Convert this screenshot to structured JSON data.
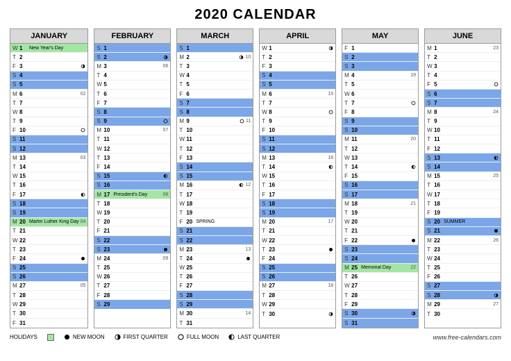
{
  "title": "2020 CALENDAR",
  "source": "www.free-calendars.com",
  "legend": {
    "holidays": "HOLIDAYS",
    "new": "NEW MOON",
    "first": "FIRST QUARTER",
    "full": "FULL MOON",
    "last": "LAST QUARTER"
  },
  "months": [
    {
      "name": "JANUARY",
      "days": [
        {
          "dw": "W",
          "n": 1,
          "hl": "green",
          "ev": "New Year's Day"
        },
        {
          "dw": "T",
          "n": 2
        },
        {
          "dw": "F",
          "n": 3,
          "moon": "first"
        },
        {
          "dw": "S",
          "n": 4,
          "hl": "blue"
        },
        {
          "dw": "S",
          "n": 5,
          "hl": "blue"
        },
        {
          "dw": "M",
          "n": 6,
          "wk": "02"
        },
        {
          "dw": "T",
          "n": 7
        },
        {
          "dw": "W",
          "n": 8
        },
        {
          "dw": "T",
          "n": 9
        },
        {
          "dw": "F",
          "n": 10,
          "moon": "full"
        },
        {
          "dw": "S",
          "n": 11,
          "hl": "blue"
        },
        {
          "dw": "S",
          "n": 12,
          "hl": "blue"
        },
        {
          "dw": "M",
          "n": 13,
          "wk": "03"
        },
        {
          "dw": "T",
          "n": 14
        },
        {
          "dw": "W",
          "n": 15
        },
        {
          "dw": "T",
          "n": 16
        },
        {
          "dw": "F",
          "n": 17,
          "moon": "last"
        },
        {
          "dw": "S",
          "n": 18,
          "hl": "blue"
        },
        {
          "dw": "S",
          "n": 19,
          "hl": "blue"
        },
        {
          "dw": "M",
          "n": 20,
          "hl": "green",
          "ev": "Martin Luther King Day",
          "wk": "04"
        },
        {
          "dw": "T",
          "n": 21
        },
        {
          "dw": "W",
          "n": 22
        },
        {
          "dw": "T",
          "n": 23
        },
        {
          "dw": "F",
          "n": 24,
          "moon": "new"
        },
        {
          "dw": "S",
          "n": 25,
          "hl": "blue"
        },
        {
          "dw": "S",
          "n": 26,
          "hl": "blue"
        },
        {
          "dw": "M",
          "n": 27,
          "wk": "05"
        },
        {
          "dw": "T",
          "n": 28
        },
        {
          "dw": "W",
          "n": 29
        },
        {
          "dw": "T",
          "n": 30
        },
        {
          "dw": "F",
          "n": 31
        }
      ]
    },
    {
      "name": "FEBRUARY",
      "days": [
        {
          "dw": "S",
          "n": 1,
          "hl": "blue"
        },
        {
          "dw": "S",
          "n": 2,
          "hl": "blue",
          "moon": "first"
        },
        {
          "dw": "M",
          "n": 3,
          "wk": "06"
        },
        {
          "dw": "T",
          "n": 4
        },
        {
          "dw": "W",
          "n": 5
        },
        {
          "dw": "T",
          "n": 6
        },
        {
          "dw": "F",
          "n": 7
        },
        {
          "dw": "S",
          "n": 8,
          "hl": "blue"
        },
        {
          "dw": "S",
          "n": 9,
          "hl": "blue",
          "moon": "full"
        },
        {
          "dw": "M",
          "n": 10,
          "wk": "07"
        },
        {
          "dw": "T",
          "n": 11
        },
        {
          "dw": "W",
          "n": 12
        },
        {
          "dw": "T",
          "n": 13
        },
        {
          "dw": "F",
          "n": 14
        },
        {
          "dw": "S",
          "n": 15,
          "hl": "blue",
          "moon": "last"
        },
        {
          "dw": "S",
          "n": 16,
          "hl": "blue"
        },
        {
          "dw": "M",
          "n": 17,
          "hl": "green",
          "ev": "President's Day",
          "wk": "08"
        },
        {
          "dw": "T",
          "n": 18
        },
        {
          "dw": "W",
          "n": 19
        },
        {
          "dw": "T",
          "n": 20
        },
        {
          "dw": "F",
          "n": 21
        },
        {
          "dw": "S",
          "n": 22,
          "hl": "blue"
        },
        {
          "dw": "S",
          "n": 23,
          "hl": "blue",
          "moon": "new"
        },
        {
          "dw": "M",
          "n": 24,
          "wk": "09"
        },
        {
          "dw": "T",
          "n": 25
        },
        {
          "dw": "W",
          "n": 26
        },
        {
          "dw": "T",
          "n": 27
        },
        {
          "dw": "F",
          "n": 28
        },
        {
          "dw": "S",
          "n": 29,
          "hl": "blue"
        }
      ]
    },
    {
      "name": "MARCH",
      "days": [
        {
          "dw": "S",
          "n": 1,
          "hl": "blue"
        },
        {
          "dw": "M",
          "n": 2,
          "moon": "first",
          "wk": "10"
        },
        {
          "dw": "T",
          "n": 3
        },
        {
          "dw": "W",
          "n": 4
        },
        {
          "dw": "T",
          "n": 5
        },
        {
          "dw": "F",
          "n": 6
        },
        {
          "dw": "S",
          "n": 7,
          "hl": "blue"
        },
        {
          "dw": "S",
          "n": 8,
          "hl": "blue"
        },
        {
          "dw": "M",
          "n": 9,
          "moon": "full",
          "wk": "11"
        },
        {
          "dw": "T",
          "n": 10
        },
        {
          "dw": "W",
          "n": 11
        },
        {
          "dw": "T",
          "n": 12
        },
        {
          "dw": "F",
          "n": 13
        },
        {
          "dw": "S",
          "n": 14,
          "hl": "blue"
        },
        {
          "dw": "S",
          "n": 15,
          "hl": "blue"
        },
        {
          "dw": "M",
          "n": 16,
          "moon": "last",
          "wk": "12"
        },
        {
          "dw": "T",
          "n": 17
        },
        {
          "dw": "W",
          "n": 18
        },
        {
          "dw": "T",
          "n": 19
        },
        {
          "dw": "F",
          "n": 20,
          "ev": "SPRING"
        },
        {
          "dw": "S",
          "n": 21,
          "hl": "blue"
        },
        {
          "dw": "S",
          "n": 22,
          "hl": "blue"
        },
        {
          "dw": "M",
          "n": 23,
          "wk": "13"
        },
        {
          "dw": "T",
          "n": 24,
          "moon": "new"
        },
        {
          "dw": "W",
          "n": 25
        },
        {
          "dw": "T",
          "n": 26
        },
        {
          "dw": "F",
          "n": 27
        },
        {
          "dw": "S",
          "n": 28,
          "hl": "blue"
        },
        {
          "dw": "S",
          "n": 29,
          "hl": "blue"
        },
        {
          "dw": "M",
          "n": 30,
          "wk": "14"
        },
        {
          "dw": "T",
          "n": 31
        }
      ]
    },
    {
      "name": "APRIL",
      "days": [
        {
          "dw": "W",
          "n": 1,
          "moon": "first"
        },
        {
          "dw": "T",
          "n": 2
        },
        {
          "dw": "F",
          "n": 3
        },
        {
          "dw": "S",
          "n": 4,
          "hl": "blue"
        },
        {
          "dw": "S",
          "n": 5,
          "hl": "blue"
        },
        {
          "dw": "M",
          "n": 6,
          "wk": "15"
        },
        {
          "dw": "T",
          "n": 7
        },
        {
          "dw": "W",
          "n": 8,
          "moon": "full"
        },
        {
          "dw": "T",
          "n": 9
        },
        {
          "dw": "F",
          "n": 10
        },
        {
          "dw": "S",
          "n": 11,
          "hl": "blue"
        },
        {
          "dw": "S",
          "n": 12,
          "hl": "blue"
        },
        {
          "dw": "M",
          "n": 13,
          "wk": "16"
        },
        {
          "dw": "T",
          "n": 14,
          "moon": "last"
        },
        {
          "dw": "W",
          "n": 15
        },
        {
          "dw": "T",
          "n": 16
        },
        {
          "dw": "F",
          "n": 17
        },
        {
          "dw": "S",
          "n": 18,
          "hl": "blue"
        },
        {
          "dw": "S",
          "n": 19,
          "hl": "blue"
        },
        {
          "dw": "M",
          "n": 20,
          "wk": "17"
        },
        {
          "dw": "T",
          "n": 21
        },
        {
          "dw": "W",
          "n": 22
        },
        {
          "dw": "T",
          "n": 23,
          "moon": "new"
        },
        {
          "dw": "F",
          "n": 24
        },
        {
          "dw": "S",
          "n": 25,
          "hl": "blue"
        },
        {
          "dw": "S",
          "n": 26,
          "hl": "blue"
        },
        {
          "dw": "M",
          "n": 27,
          "wk": "18"
        },
        {
          "dw": "T",
          "n": 28
        },
        {
          "dw": "W",
          "n": 29
        },
        {
          "dw": "T",
          "n": 30,
          "moon": "first"
        }
      ]
    },
    {
      "name": "MAY",
      "days": [
        {
          "dw": "F",
          "n": 1
        },
        {
          "dw": "S",
          "n": 2,
          "hl": "blue"
        },
        {
          "dw": "S",
          "n": 3,
          "hl": "blue"
        },
        {
          "dw": "M",
          "n": 4,
          "wk": "19"
        },
        {
          "dw": "T",
          "n": 5
        },
        {
          "dw": "W",
          "n": 6
        },
        {
          "dw": "T",
          "n": 7,
          "moon": "full"
        },
        {
          "dw": "F",
          "n": 8
        },
        {
          "dw": "S",
          "n": 9,
          "hl": "blue"
        },
        {
          "dw": "S",
          "n": 10,
          "hl": "blue"
        },
        {
          "dw": "M",
          "n": 11,
          "wk": "20"
        },
        {
          "dw": "T",
          "n": 12
        },
        {
          "dw": "W",
          "n": 13
        },
        {
          "dw": "T",
          "n": 14,
          "moon": "last"
        },
        {
          "dw": "F",
          "n": 15
        },
        {
          "dw": "S",
          "n": 16,
          "hl": "blue"
        },
        {
          "dw": "S",
          "n": 17,
          "hl": "blue"
        },
        {
          "dw": "M",
          "n": 18,
          "wk": "21"
        },
        {
          "dw": "T",
          "n": 19
        },
        {
          "dw": "W",
          "n": 20
        },
        {
          "dw": "T",
          "n": 21
        },
        {
          "dw": "F",
          "n": 22,
          "moon": "new"
        },
        {
          "dw": "S",
          "n": 23,
          "hl": "blue"
        },
        {
          "dw": "S",
          "n": 24,
          "hl": "blue"
        },
        {
          "dw": "M",
          "n": 25,
          "hl": "green",
          "ev": "Memorial Day",
          "wk": "22"
        },
        {
          "dw": "T",
          "n": 26
        },
        {
          "dw": "W",
          "n": 27
        },
        {
          "dw": "T",
          "n": 28
        },
        {
          "dw": "F",
          "n": 29
        },
        {
          "dw": "S",
          "n": 30,
          "hl": "blue",
          "moon": "first"
        },
        {
          "dw": "S",
          "n": 31,
          "hl": "blue"
        }
      ]
    },
    {
      "name": "JUNE",
      "days": [
        {
          "dw": "M",
          "n": 1,
          "wk": "23"
        },
        {
          "dw": "T",
          "n": 2
        },
        {
          "dw": "W",
          "n": 3
        },
        {
          "dw": "T",
          "n": 4
        },
        {
          "dw": "F",
          "n": 5,
          "moon": "full"
        },
        {
          "dw": "S",
          "n": 6,
          "hl": "blue"
        },
        {
          "dw": "S",
          "n": 7,
          "hl": "blue"
        },
        {
          "dw": "M",
          "n": 8,
          "wk": "24"
        },
        {
          "dw": "T",
          "n": 9
        },
        {
          "dw": "W",
          "n": 10
        },
        {
          "dw": "T",
          "n": 11
        },
        {
          "dw": "F",
          "n": 12
        },
        {
          "dw": "S",
          "n": 13,
          "hl": "blue",
          "moon": "last"
        },
        {
          "dw": "S",
          "n": 14,
          "hl": "blue"
        },
        {
          "dw": "M",
          "n": 15,
          "wk": "25"
        },
        {
          "dw": "T",
          "n": 16
        },
        {
          "dw": "W",
          "n": 17
        },
        {
          "dw": "T",
          "n": 18
        },
        {
          "dw": "F",
          "n": 19
        },
        {
          "dw": "S",
          "n": 20,
          "hl": "blue",
          "ev": "SUMMER"
        },
        {
          "dw": "S",
          "n": 21,
          "hl": "blue",
          "moon": "new"
        },
        {
          "dw": "M",
          "n": 22,
          "wk": "26"
        },
        {
          "dw": "T",
          "n": 23
        },
        {
          "dw": "W",
          "n": 24
        },
        {
          "dw": "T",
          "n": 25
        },
        {
          "dw": "F",
          "n": 26
        },
        {
          "dw": "S",
          "n": 27,
          "hl": "blue"
        },
        {
          "dw": "S",
          "n": 28,
          "hl": "blue",
          "moon": "first"
        },
        {
          "dw": "M",
          "n": 29,
          "wk": "27"
        },
        {
          "dw": "T",
          "n": 30
        }
      ]
    }
  ]
}
